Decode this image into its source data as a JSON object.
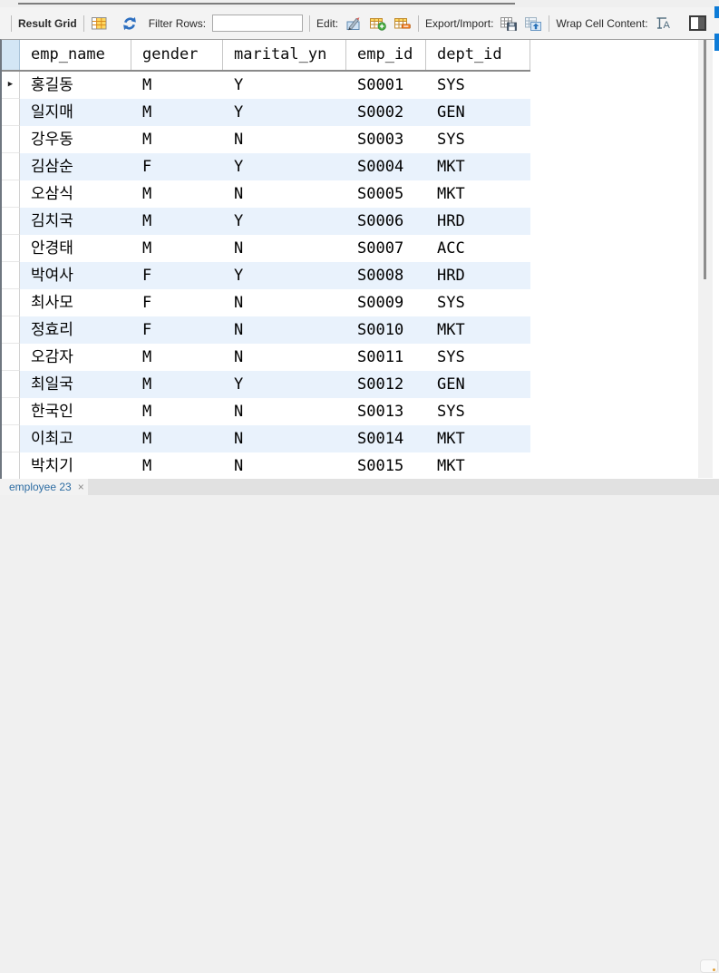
{
  "toolbar": {
    "result_grid_label": "Result Grid",
    "filter_rows_label": "Filter Rows:",
    "filter_input_value": "",
    "edit_label": "Edit:",
    "export_import_label": "Export/Import:",
    "wrap_cell_content_label": "Wrap Cell Content:",
    "wrap_icon_letter": "A",
    "icons": [
      "result-grid-icon",
      "refresh-icon",
      "edit-pencil-icon",
      "add-row-icon",
      "delete-row-icon",
      "export-icon",
      "import-icon",
      "wrap-cell-icon",
      "panel-toggle-icon"
    ]
  },
  "grid": {
    "columns": [
      "emp_name",
      "gender",
      "marital_yn",
      "emp_id",
      "dept_id"
    ],
    "rows": [
      [
        "홍길동",
        "M",
        "Y",
        "S0001",
        "SYS"
      ],
      [
        "일지매",
        "M",
        "Y",
        "S0002",
        "GEN"
      ],
      [
        "강우동",
        "M",
        "N",
        "S0003",
        "SYS"
      ],
      [
        "김삼순",
        "F",
        "Y",
        "S0004",
        "MKT"
      ],
      [
        "오삼식",
        "M",
        "N",
        "S0005",
        "MKT"
      ],
      [
        "김치국",
        "M",
        "Y",
        "S0006",
        "HRD"
      ],
      [
        "안경태",
        "M",
        "N",
        "S0007",
        "ACC"
      ],
      [
        "박여사",
        "F",
        "Y",
        "S0008",
        "HRD"
      ],
      [
        "최사모",
        "F",
        "N",
        "S0009",
        "SYS"
      ],
      [
        "정효리",
        "F",
        "N",
        "S0010",
        "MKT"
      ],
      [
        "오감자",
        "M",
        "N",
        "S0011",
        "SYS"
      ],
      [
        "최일국",
        "M",
        "Y",
        "S0012",
        "GEN"
      ],
      [
        "한국인",
        "M",
        "N",
        "S0013",
        "SYS"
      ],
      [
        "이최고",
        "M",
        "N",
        "S0014",
        "MKT"
      ],
      [
        "박치기",
        "M",
        "N",
        "S0015",
        "MKT"
      ]
    ],
    "current_row_index": 0,
    "current_row_marker": "▶"
  },
  "tabs": {
    "active_tab_label": "employee 23",
    "close_glyph": "×"
  },
  "colors": {
    "accent_blue": "#0d7bd7",
    "alt_row": "#e9f2fc",
    "selector_header": "#d3e6f5",
    "tab_text": "#2d6ca2",
    "grid_icon_yellow": "#ffd75e"
  }
}
